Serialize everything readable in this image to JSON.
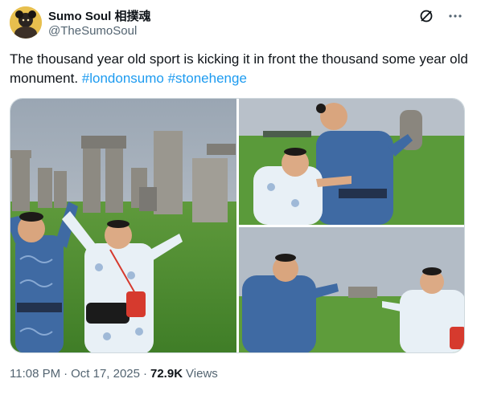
{
  "author": {
    "display_name": "Sumo Soul 相撲魂",
    "handle": "@TheSumoSoul"
  },
  "tweet": {
    "text": "The thousand year old sport is kicking it in front the thousand some year old monument.",
    "hashtags": [
      "#londonsumo",
      "#stonehenge"
    ]
  },
  "header_icons": [
    "grok-icon",
    "more-icon"
  ],
  "media": {
    "photos": [
      {
        "name": "photo-stonehenge-arms-raised"
      },
      {
        "name": "photo-lean-on-wrestler"
      },
      {
        "name": "photo-holding-stonehenge"
      }
    ]
  },
  "meta": {
    "time": "11:08 PM",
    "separator": "·",
    "date": "Oct 17, 2025",
    "views_count": "72.9K",
    "views_label": "Views"
  },
  "colors": {
    "link": "#1d9bf0",
    "secondary_text": "#536471",
    "primary_text": "#0f1419",
    "border": "#cfd9de"
  }
}
